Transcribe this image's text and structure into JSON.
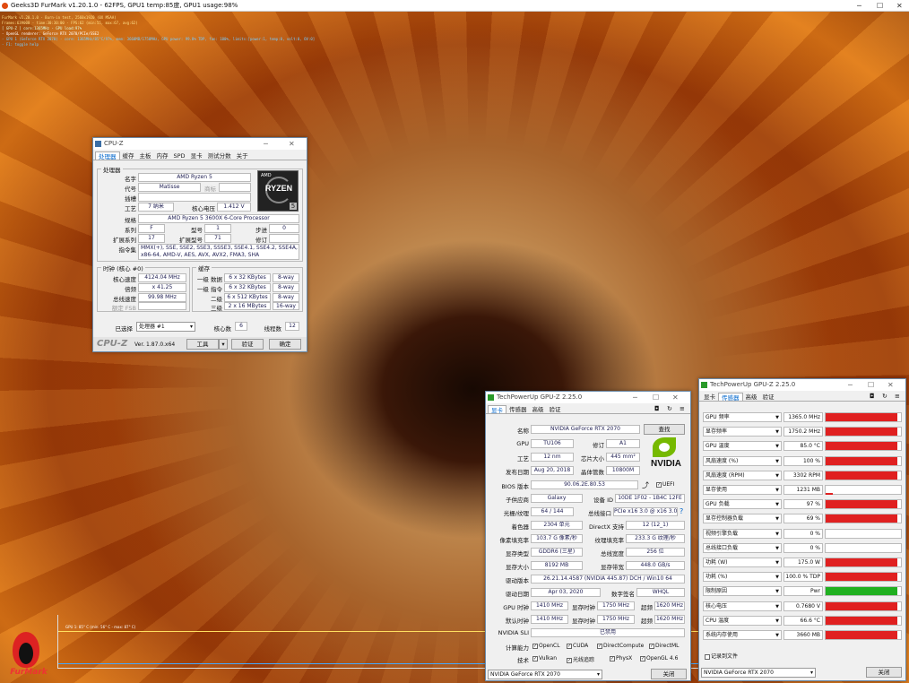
{
  "furmark": {
    "title": "Geeks3D FurMark v1.20.1.0 - 62FPS, GPU1 temp:85度, GPU1 usage:98%",
    "overlay": [
      "FurMark v1.20.1.0 - Burn-in test, 2560x1920 (0X MSAA)",
      "Frames:639000 - time:30:30:00 - FPS:62 (min:55, max:67, avg:62)",
      "[ GPU-Z ] core:1365MHz - GPU load:97%",
      "- OpenGL renderer: GeForce RTX 2070/PCIe/SSE2",
      "- GPU 1 (GeForce RTX 2070) - core: 1365MHz/85°C/97%, mem: 3660MB/1750MHz, GPU power: 99.8% TDP, fan: 100%, limits:[power:1, temp:0, volt:0, OV:0]",
      "- F1: toggle help"
    ],
    "graph_label": "GPU 1: 85° C (min: 56° C - max: 87° C)",
    "logo_text": "FurMark"
  },
  "cpuz": {
    "title": "CPU-Z",
    "tabs": [
      "处理器",
      "缓存",
      "主板",
      "内存",
      "SPD",
      "显卡",
      "测试分数",
      "关于"
    ],
    "processor_legend": "处理器",
    "labels": {
      "name": "名字",
      "code": "代号",
      "package": "插槽",
      "tech": "工艺",
      "core_voltage": "核心电压",
      "spec": "规格",
      "family": "系列",
      "model": "型号",
      "stepping": "步进",
      "ext_family": "扩展系列",
      "ext_model": "扩展型号",
      "revision": "修订",
      "instructions": "指令集",
      "trademark": "商标"
    },
    "values": {
      "name": "AMD Ryzen 5",
      "code": "Matisse",
      "trademark": "",
      "package": "",
      "tech": "7 纳米",
      "core_voltage": "1.412 V",
      "spec": "AMD Ryzen 5 3600X 6-Core Processor",
      "family": "F",
      "model": "1",
      "stepping": "0",
      "ext_family": "17",
      "ext_model": "71",
      "revision": "",
      "instructions": "MMX(+), SSE, SSE2, SSE3, SSSE3, SSE4.1, SSE4.2, SSE4A, x86-64, AMD-V, AES, AVX, AVX2, FMA3, SHA"
    },
    "logo": {
      "brand": "AMD",
      "text": "RYZEN",
      "num": "5"
    },
    "clocks_legend": "时钟 (核心 #0)",
    "clocks": {
      "core_speed_label": "核心速度",
      "core_speed": "4124.04 MHz",
      "multiplier_label": "倍频",
      "multiplier": "x 41.25",
      "bus_label": "总线速度",
      "bus": "99.98 MHz",
      "fsb_label": "额定 FSB",
      "fsb": ""
    },
    "cache_legend": "缓存",
    "cache": [
      {
        "label": "一级 数据",
        "size": "6 x 32 KBytes",
        "way": "8-way"
      },
      {
        "label": "一级 指令",
        "size": "6 x 32 KBytes",
        "way": "8-way"
      },
      {
        "label": "二级",
        "size": "6 x 512 KBytes",
        "way": "8-way"
      },
      {
        "label": "三级",
        "size": "2 x 16 MBytes",
        "way": "16-way"
      }
    ],
    "selected_label": "已选择",
    "selected_value": "处理器 #1",
    "cores_label": "核心数",
    "cores": "6",
    "threads_label": "线程数",
    "threads": "12",
    "footer": {
      "brand": "CPU-Z",
      "version": "Ver. 1.87.0.x64",
      "tools": "工具",
      "validate": "验证",
      "ok": "确定"
    }
  },
  "gpuz1": {
    "title": "TechPowerUp GPU-Z 2.25.0",
    "tabs": [
      "显卡",
      "传感器",
      "高级",
      "验证"
    ],
    "rows": {
      "name_label": "名称",
      "name": "NVIDIA GeForce RTX 2070",
      "lookup": "查找",
      "gpu_label": "GPU",
      "gpu": "TU106",
      "rev_label": "修订",
      "rev": "A1",
      "tech_label": "工艺",
      "tech": "12 nm",
      "die_label": "芯片大小",
      "die": "445 mm²",
      "release_label": "发布日期",
      "release": "Aug 20, 2018",
      "trans_label": "晶体管数",
      "trans": "10800M",
      "bios_label": "BIOS 版本",
      "bios": "90.06.2E.80.53",
      "uefi": "UEFI",
      "subvendor_label": "子供应商",
      "subvendor": "Galaxy",
      "devid_label": "设备 ID",
      "devid": "10DE 1F02 - 1B4C 12FE",
      "rops_label": "光栅/纹理",
      "rops": "64 / 144",
      "bus_label": "总线接口",
      "bus": "PCIe x16 3.0 @ x16 3.0",
      "shaders_label": "着色器",
      "shaders": "2304 单元",
      "dx_label": "DirectX 支持",
      "dx": "12 (12_1)",
      "pixel_label": "像素填充率",
      "pixel": "103.7 G 像素/秒",
      "tex_label": "纹理填充率",
      "tex": "233.3 G 纹理/秒",
      "memtype_label": "显存类型",
      "memtype": "GDDR6 (三星)",
      "buswidth_label": "总线宽度",
      "buswidth": "256 位",
      "memsize_label": "显存大小",
      "memsize": "8192 MB",
      "bandwidth_label": "显存带宽",
      "bandwidth": "448.0 GB/s",
      "driver_label": "驱动版本",
      "driver": "26.21.14.4587 (NVIDIA 445.87) DCH / Win10 64",
      "drvdate_label": "驱动日期",
      "drvdate": "Apr 03, 2020",
      "sig_label": "数字签名",
      "sig": "WHQL",
      "gpuclk_label": "GPU 时钟",
      "gpuclk": "1410 MHz",
      "memclk_label": "显存时钟",
      "memclk": "1750 MHz",
      "boost_label": "超频",
      "boost": "1620 MHz",
      "defclk_label": "默认时钟",
      "defclk": "1410 MHz",
      "defmem_label": "显存时钟",
      "defmem": "1750 MHz",
      "defboost_label": "超频",
      "defboost": "1620 MHz",
      "sli_label": "NVIDIA SLI",
      "sli": "已禁用",
      "compute_label": "计算能力",
      "tech2_label": "技术"
    },
    "compute": [
      "OpenCL",
      "CUDA",
      "DirectCompute",
      "DirectML"
    ],
    "technologies": [
      "Vulkan",
      "光线追踪",
      "PhysX",
      "OpenGL 4.6"
    ],
    "nvidia_text": "NVIDIA",
    "select_value": "NVIDIA GeForce RTX 2070",
    "close": "关闭"
  },
  "gpuz2": {
    "title": "TechPowerUp GPU-Z 2.25.0",
    "tabs": [
      "显卡",
      "传感器",
      "高级",
      "验证"
    ],
    "sensors": [
      {
        "name": "GPU 频率",
        "value": "1365.0 MHz",
        "level": 0.95,
        "color": "#e02020"
      },
      {
        "name": "显存频率",
        "value": "1750.2 MHz",
        "level": 0.95,
        "color": "#e02020"
      },
      {
        "name": "GPU 温度",
        "value": "85.0 °C",
        "level": 0.95,
        "color": "#e02020"
      },
      {
        "name": "风扇速度 (%)",
        "value": "100 %",
        "level": 0.95,
        "color": "#e02020"
      },
      {
        "name": "风扇速度 (RPM)",
        "value": "3302 RPM",
        "level": 0.95,
        "color": "#e02020"
      },
      {
        "name": "显存使用",
        "value": "1231 MB",
        "level": 0.1,
        "color": "#e02020"
      },
      {
        "name": "GPU 负载",
        "value": "97 %",
        "level": 0.95,
        "color": "#e02020"
      },
      {
        "name": "显存控制器负载",
        "value": "69 %",
        "level": 0.95,
        "color": "#e02020"
      },
      {
        "name": "视频引擎负载",
        "value": "0 %",
        "level": 0,
        "color": "#e02020"
      },
      {
        "name": "总线接口负载",
        "value": "0 %",
        "level": 0,
        "color": "#e02020"
      },
      {
        "name": "功耗 (W)",
        "value": "175.0 W",
        "level": 0.95,
        "color": "#e02020"
      },
      {
        "name": "功耗 (%)",
        "value": "100.0 % TDP",
        "level": 0.95,
        "color": "#e02020"
      },
      {
        "name": "限制原因",
        "value": "Pwr",
        "level": 0.95,
        "color": "#20b020"
      },
      {
        "name": "核心电压",
        "value": "0.7680 V",
        "level": 0.95,
        "color": "#e02020"
      },
      {
        "name": "CPU 温度",
        "value": "66.6 °C",
        "level": 0.95,
        "color": "#e02020"
      },
      {
        "name": "系统内存使用",
        "value": "3660 MB",
        "level": 0.95,
        "color": "#e02020"
      }
    ],
    "log_label": "记录到文件",
    "select_value": "NVIDIA GeForce RTX 2070",
    "close": "关闭"
  }
}
